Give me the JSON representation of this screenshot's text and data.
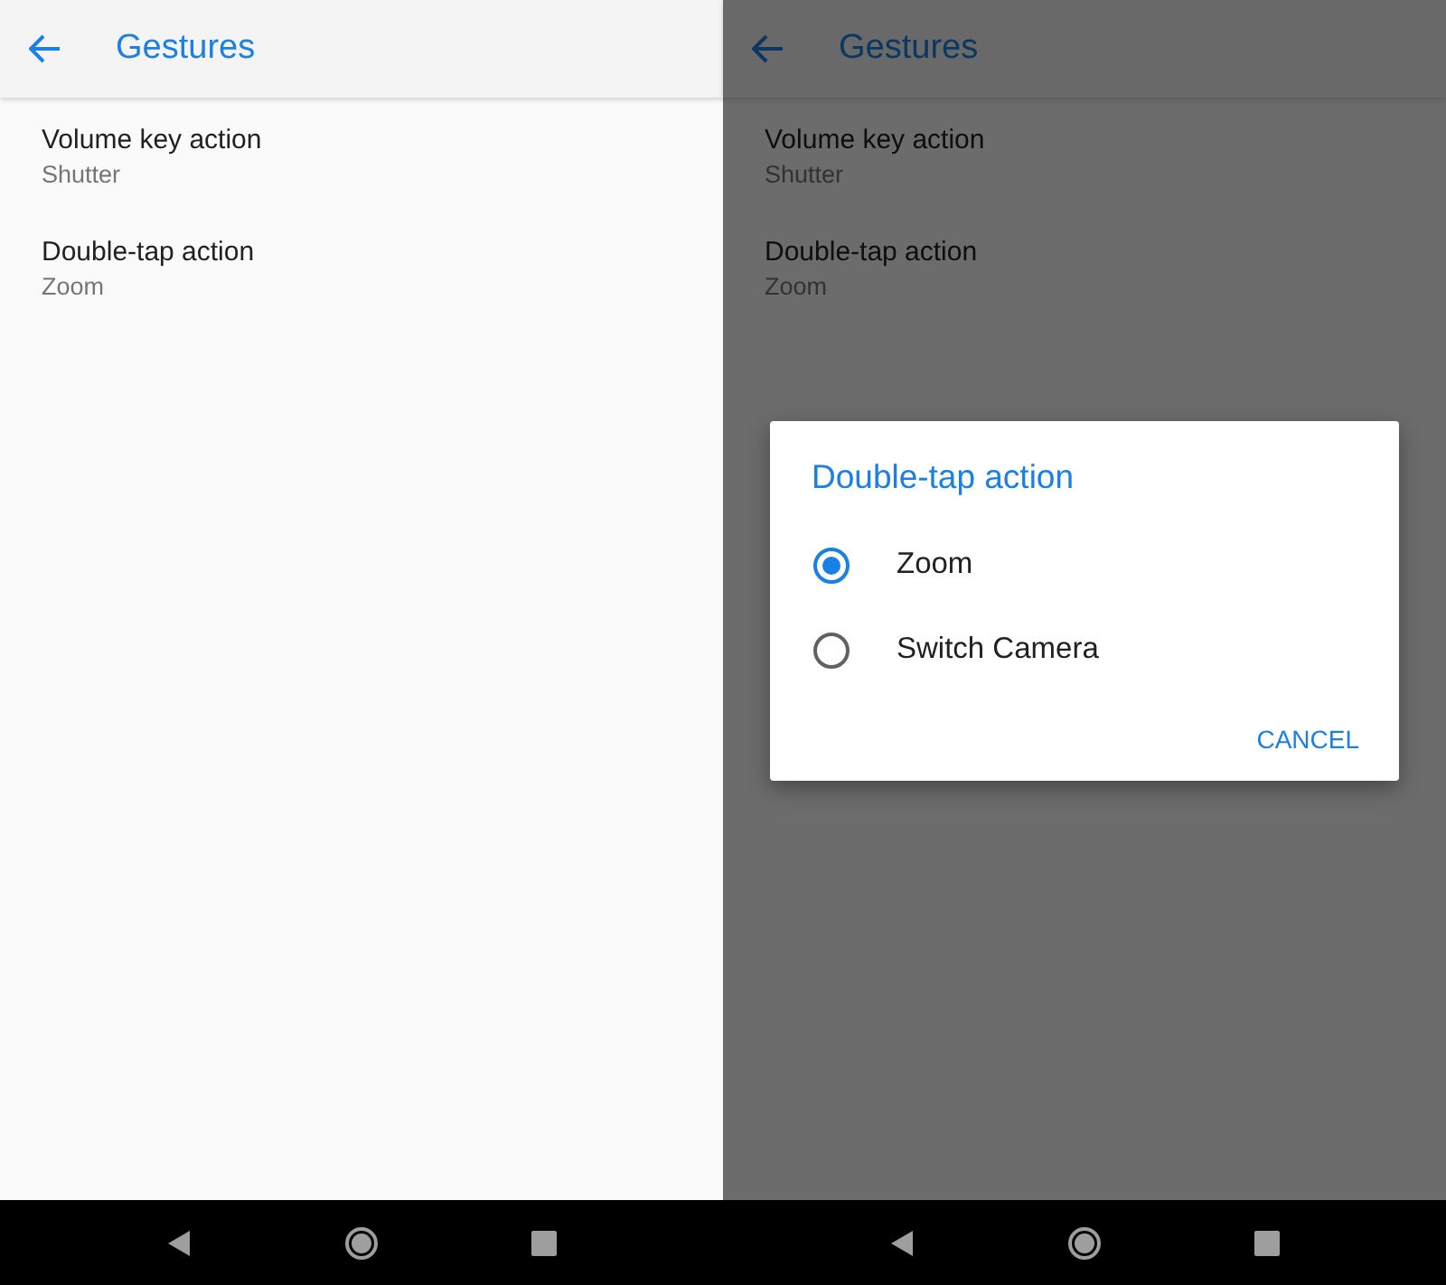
{
  "screens": [
    {
      "title": "Gestures",
      "items": [
        {
          "title": "Volume key action",
          "summary": "Shutter"
        },
        {
          "title": "Double-tap action",
          "summary": "Zoom"
        }
      ]
    },
    {
      "title": "Gestures",
      "items": [
        {
          "title": "Volume key action",
          "summary": "Shutter"
        },
        {
          "title": "Double-tap action",
          "summary": "Zoom"
        }
      ],
      "dialog": {
        "title": "Double-tap action",
        "options": [
          {
            "label": "Zoom",
            "selected": true
          },
          {
            "label": "Switch Camera",
            "selected": false
          }
        ],
        "button": "CANCEL"
      }
    }
  ]
}
